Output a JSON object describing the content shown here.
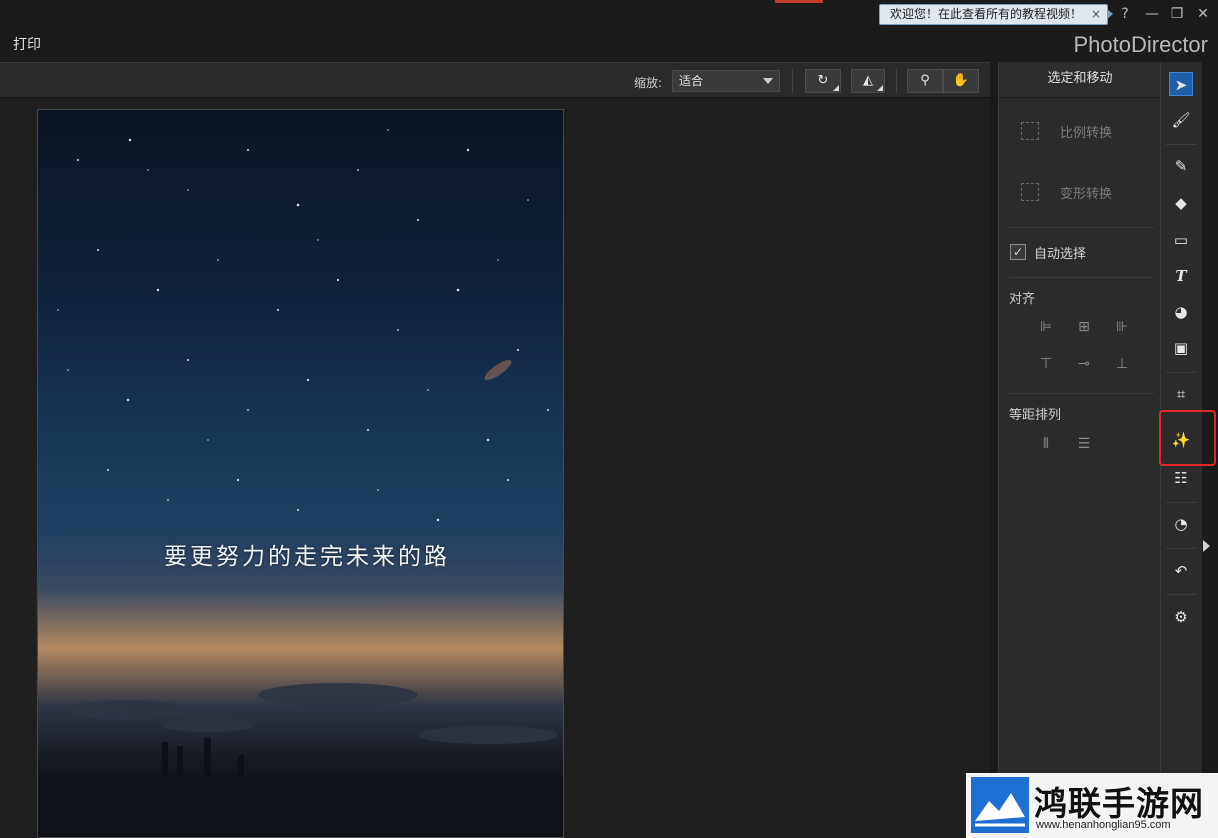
{
  "titlebar": {
    "tip_text": "欢迎您！在此查看所有的教程视频！",
    "tip_close": "×",
    "help": "?",
    "minimize": "—",
    "restore": "❐",
    "close": "✕"
  },
  "menubar": {
    "print": "打印",
    "brand": "PhotoDirector"
  },
  "toolbar": {
    "zoom_label": "缩放:",
    "zoom_value": "适合"
  },
  "canvas": {
    "caption": "要更努力的走完未来的路"
  },
  "panel": {
    "title": "选定和移动",
    "scale_transform": "比例转换",
    "warp_transform": "变形转换",
    "auto_select": "自动选择",
    "auto_select_checked": true,
    "align_heading": "对齐",
    "distribute_heading": "等距排列"
  },
  "tools": [
    {
      "name": "select-move-tool-icon",
      "active": true
    },
    {
      "name": "brush-stack-icon"
    },
    {
      "name": "pencil-icon"
    },
    {
      "name": "eraser-icon"
    },
    {
      "name": "rectangle-icon"
    },
    {
      "name": "text-tool-icon"
    },
    {
      "name": "paint-bucket-icon"
    },
    {
      "name": "gradient-icon"
    },
    {
      "name": "crop-icon"
    },
    {
      "name": "magic-wand-icon",
      "highlighted": true
    },
    {
      "name": "adjust-sliders-icon"
    },
    {
      "name": "color-balance-icon"
    },
    {
      "name": "history-icon"
    },
    {
      "name": "settings-gear-icon"
    }
  ],
  "watermark": {
    "title": "鸿联手游网",
    "url": "www.henanhonglian95.com"
  },
  "colors": {
    "accent_blue": "#1f5fa8",
    "highlight_red": "#e0262a"
  }
}
